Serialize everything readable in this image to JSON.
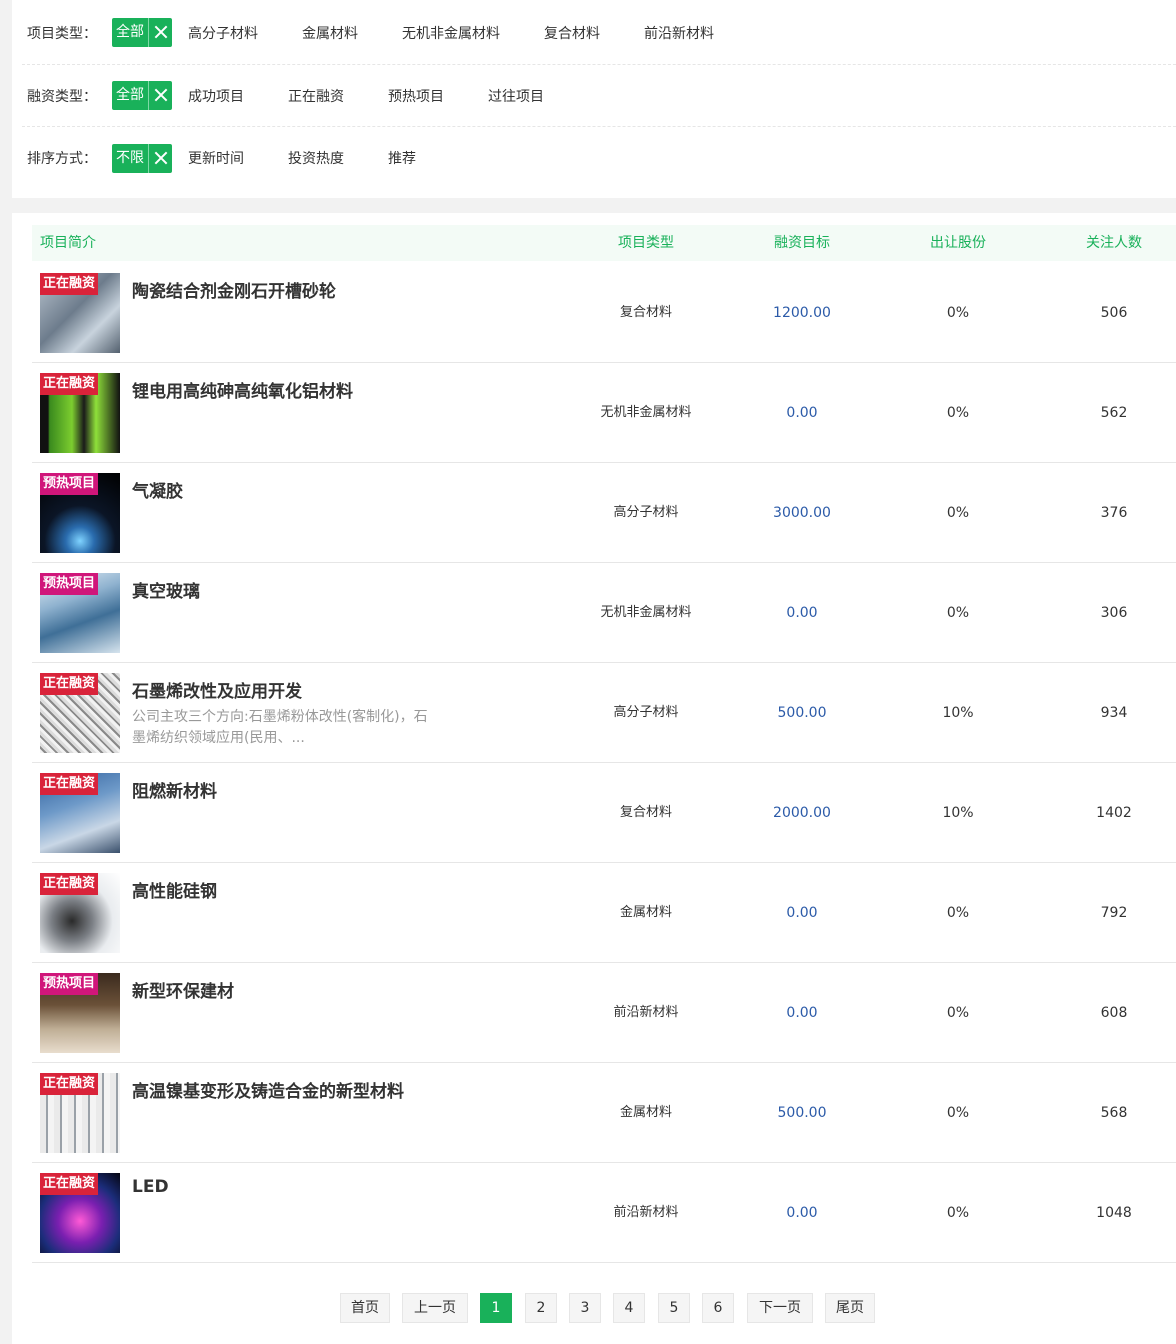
{
  "filters": {
    "project_type": {
      "label": "项目类型：",
      "active": "全部",
      "options": [
        "高分子材料",
        "金属材料",
        "无机非金属材料",
        "复合材料",
        "前沿新材料"
      ]
    },
    "financing_type": {
      "label": "融资类型：",
      "active": "全部",
      "options": [
        "成功项目",
        "正在融资",
        "预热项目",
        "过往项目"
      ]
    },
    "sort": {
      "label": "排序方式：",
      "active": "不限",
      "options": [
        "更新时间",
        "投资热度",
        "推荐"
      ]
    }
  },
  "table": {
    "headers": [
      "项目简介",
      "项目类型",
      "融资目标",
      "出让股份",
      "关注人数"
    ],
    "rows": [
      {
        "badge": "正在融资",
        "badge_color": "#d9233a",
        "title": "陶瓷结合剂金刚石开槽砂轮",
        "desc": "",
        "type": "复合材料",
        "target": "1200.00",
        "share": "0%",
        "followers": "506"
      },
      {
        "badge": "正在融资",
        "badge_color": "#d9233a",
        "title": "锂电用高纯砷高纯氧化铝材料",
        "desc": "",
        "type": "无机非金属材料",
        "target": "0.00",
        "share": "0%",
        "followers": "562"
      },
      {
        "badge": "预热项目",
        "badge_color": "#d0167a",
        "title": "气凝胶",
        "desc": "",
        "type": "高分子材料",
        "target": "3000.00",
        "share": "0%",
        "followers": "376"
      },
      {
        "badge": "预热项目",
        "badge_color": "#d0167a",
        "title": "真空玻璃",
        "desc": "",
        "type": "无机非金属材料",
        "target": "0.00",
        "share": "0%",
        "followers": "306"
      },
      {
        "badge": "正在融资",
        "badge_color": "#d9233a",
        "title": "石墨烯改性及应用开发",
        "desc": "公司主攻三个方向:石墨烯粉体改性(客制化)，石墨烯纺织领域应用(民用、...",
        "type": "高分子材料",
        "target": "500.00",
        "share": "10%",
        "followers": "934"
      },
      {
        "badge": "正在融资",
        "badge_color": "#d9233a",
        "title": "阻燃新材料",
        "desc": "",
        "type": "复合材料",
        "target": "2000.00",
        "share": "10%",
        "followers": "1402"
      },
      {
        "badge": "正在融资",
        "badge_color": "#d9233a",
        "title": "高性能硅钢",
        "desc": "",
        "type": "金属材料",
        "target": "0.00",
        "share": "0%",
        "followers": "792"
      },
      {
        "badge": "预热项目",
        "badge_color": "#d0167a",
        "title": "新型环保建材",
        "desc": "",
        "type": "前沿新材料",
        "target": "0.00",
        "share": "0%",
        "followers": "608"
      },
      {
        "badge": "正在融资",
        "badge_color": "#d9233a",
        "title": "高温镍基变形及铸造合金的新型材料",
        "desc": "",
        "type": "金属材料",
        "target": "500.00",
        "share": "0%",
        "followers": "568"
      },
      {
        "badge": "正在融资",
        "badge_color": "#d9233a",
        "title": "LED",
        "desc": "",
        "type": "前沿新材料",
        "target": "0.00",
        "share": "0%",
        "followers": "1048"
      }
    ]
  },
  "pagination": {
    "first": "首页",
    "prev": "上一页",
    "pages": [
      "1",
      "2",
      "3",
      "4",
      "5",
      "6"
    ],
    "current": "1",
    "next": "下一页",
    "last": "尾页"
  }
}
